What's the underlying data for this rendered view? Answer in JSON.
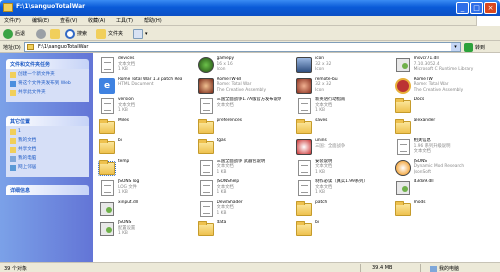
{
  "window": {
    "title": "F:\\1\\sanguoTotalWar"
  },
  "menu": [
    "文件(F)",
    "编辑(E)",
    "查看(V)",
    "收藏(A)",
    "工具(T)",
    "帮助(H)"
  ],
  "toolbar": {
    "back": "后退",
    "search": "搜索",
    "folders": "文件夹"
  },
  "address": {
    "label": "地址(D)",
    "value": "F:\\1\\sanguoTotalWar",
    "go": "转到"
  },
  "sidebar": {
    "tasks": {
      "title": "文件和文件夹任务",
      "items": [
        "创建一个新文件夹",
        "将这个文件夹发布到 Web",
        "共享此文件夹"
      ]
    },
    "places": {
      "title": "其它位置",
      "items": [
        "1",
        "我的文档",
        "共享文档",
        "我的电脑",
        "网上邻居"
      ]
    },
    "details": {
      "title": "详细信息"
    }
  },
  "items": [
    {
      "name": "devices",
      "meta1": "文本文档",
      "meta2": "1 KB",
      "icon": "doc"
    },
    {
      "name": "gamepy",
      "meta1": "16 x 16",
      "meta2": "Icon",
      "icon": "pic-green"
    },
    {
      "name": "icon",
      "meta1": "32 x 32",
      "meta2": "Icon",
      "icon": "pic-sail"
    },
    {
      "name": "msvcr71.dll",
      "meta1": "7.10.3052.4",
      "meta2": "Microsoft C Runtime Library",
      "icon": "dll"
    },
    {
      "name": "Rome Total War 1.3 patch Read me ENG",
      "meta1": "HTML Document",
      "meta2": "",
      "icon": "ie"
    },
    {
      "name": "RomeTW-BI",
      "meta1": "Rome: Total War",
      "meta2": "The Creative Assembly",
      "icon": "pic-red"
    },
    {
      "name": "remote-bu",
      "meta1": "32 x 32",
      "meta2": "Icon",
      "icon": "pic-red2"
    },
    {
      "name": "RomeTW",
      "meta1": "Rome: Total War",
      "meta2": "The Creative Assembly",
      "icon": "exe"
    },
    {
      "name": "version",
      "meta1": "文本文档",
      "meta2": "1 KB",
      "icon": "doc"
    },
    {
      "name": "三国全面战争1.7A版官方发布说明",
      "meta1": "文本文档",
      "meta2": "",
      "icon": "doc"
    },
    {
      "name": "新英语行动指南",
      "meta1": "文本文档",
      "meta2": "1 KB",
      "icon": "doc"
    },
    {
      "name": "Docs",
      "meta1": "",
      "meta2": "",
      "icon": "folder"
    },
    {
      "name": "Miles",
      "meta1": "",
      "meta2": "",
      "icon": "folder"
    },
    {
      "name": "preferences",
      "meta1": "",
      "meta2": "",
      "icon": "folder"
    },
    {
      "name": "saves",
      "meta1": "",
      "meta2": "",
      "icon": "folder"
    },
    {
      "name": "alexander",
      "meta1": "",
      "meta2": "",
      "icon": "folder"
    },
    {
      "name": "bi",
      "meta1": "",
      "meta2": "",
      "icon": "folder"
    },
    {
      "name": "tgas",
      "meta1": "",
      "meta2": "",
      "icon": "folder"
    },
    {
      "name": "unins",
      "meta1": "三国：全面战争",
      "meta2": "",
      "icon": "pic-gear"
    },
    {
      "name": "相关信息",
      "meta1": "1.96 系列升级说明",
      "meta2": "文本文档",
      "icon": "doc"
    },
    {
      "name": "temp",
      "meta1": "",
      "meta2": "",
      "icon": "folder-sel"
    },
    {
      "name": "三国全面战争 武器包说明",
      "meta1": "文本文档",
      "meta2": "1 KB",
      "icon": "doc"
    },
    {
      "name": "安装说明",
      "meta1": "文本文档",
      "meta2": "1 KB",
      "icon": "doc"
    },
    {
      "name": "JSONS",
      "meta1": "Dynamic Mod Research",
      "meta2": "JsonSoft",
      "icon": "pic-c"
    },
    {
      "name": "JSONS log",
      "meta1": "LOG 文件",
      "meta2": "1 KB",
      "icon": "doc"
    },
    {
      "name": "JSONShelp",
      "meta1": "文本文档",
      "meta2": "1 KB",
      "icon": "doc"
    },
    {
      "name": "制作必读（真实1.99系列）",
      "meta1": "文本文档",
      "meta2": "1 KB",
      "icon": "doc"
    },
    {
      "name": "d3dx9.dll",
      "meta1": "",
      "meta2": "",
      "icon": "dll"
    },
    {
      "name": "xinput.dll",
      "meta1": "",
      "meta2": "",
      "icon": "dll"
    },
    {
      "name": "DevilShader",
      "meta1": "文本文档",
      "meta2": "1 KB",
      "icon": "doc"
    },
    {
      "name": "patch",
      "meta1": "",
      "meta2": "",
      "icon": "folder"
    },
    {
      "name": "mods",
      "meta1": "",
      "meta2": "",
      "icon": "folder"
    },
    {
      "name": "JSONS",
      "meta1": "配置设置",
      "meta2": "1 KB",
      "icon": "dll"
    },
    {
      "name": "data",
      "meta1": "",
      "meta2": "",
      "icon": "folder"
    },
    {
      "name": "bi",
      "meta1": "",
      "meta2": "",
      "icon": "folder"
    }
  ],
  "status": {
    "left": "39 个对象",
    "size": "39.4 MB",
    "location": "我的电脑"
  },
  "colors": {
    "title": "#0a5bd8",
    "sidebar": "#6375d6",
    "link": "#215dc6"
  }
}
